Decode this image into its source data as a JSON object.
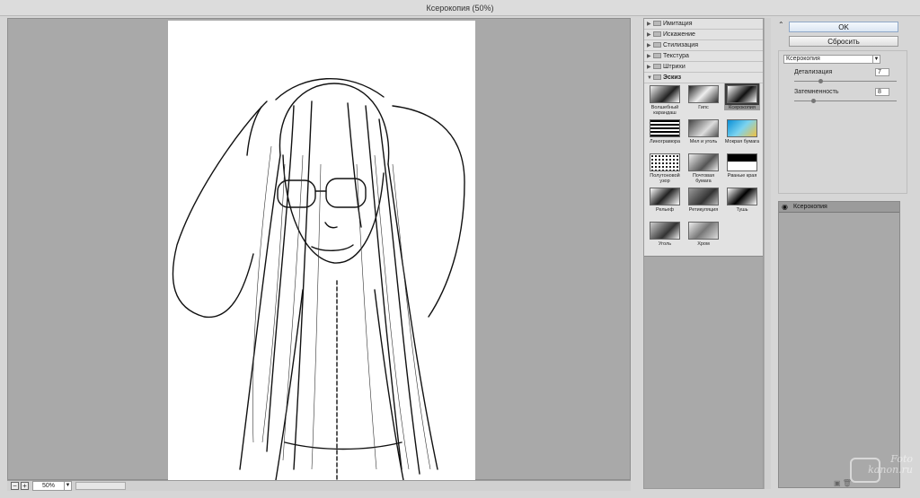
{
  "window": {
    "title": "Ксерокопия (50%)"
  },
  "preview": {
    "zoom": "50%"
  },
  "gallery": {
    "categories": [
      {
        "label": "Имитация",
        "open": false
      },
      {
        "label": "Искажение",
        "open": false
      },
      {
        "label": "Стилизация",
        "open": false
      },
      {
        "label": "Текстура",
        "open": false
      },
      {
        "label": "Штрихи",
        "open": false
      },
      {
        "label": "Эскиз",
        "open": true
      }
    ],
    "filters": [
      "Волшебный карандаш",
      "Гипс",
      "Ксерокопия",
      "Линогравюра",
      "Мел и уголь",
      "Мокрая бумага",
      "Полутоновой узор",
      "Почтовая бумага",
      "Рваные края",
      "Рельеф",
      "Ретикуляция",
      "Тушь",
      "Уголь",
      "Хром"
    ],
    "selected_filter": "Ксерокопия"
  },
  "controls": {
    "ok_label": "OK",
    "reset_label": "Сбросить",
    "filter_select": "Ксерокопия",
    "params": [
      {
        "label": "Детализация",
        "value": "7",
        "level": 0.25
      },
      {
        "label": "Затемненность",
        "value": "8",
        "level": 0.17
      }
    ]
  },
  "layers": {
    "items": [
      {
        "label": "Ксерокопия"
      }
    ]
  },
  "watermark": {
    "line1": "Foto",
    "line2": "kanon.ru"
  }
}
